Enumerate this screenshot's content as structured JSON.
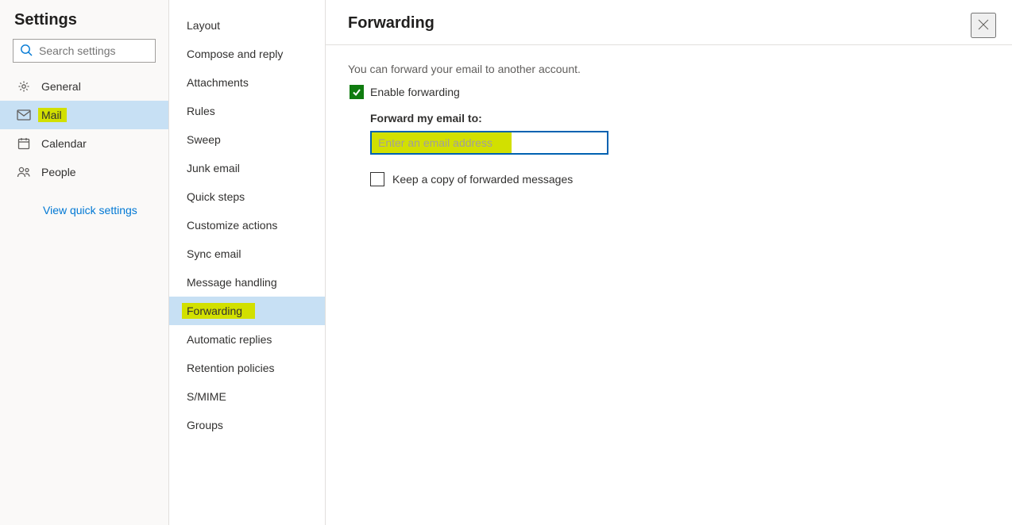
{
  "left": {
    "heading": "Settings",
    "search_placeholder": "Search settings",
    "items": [
      {
        "id": "general",
        "label": "General",
        "icon": "gear"
      },
      {
        "id": "mail",
        "label": "Mail",
        "icon": "mail",
        "selected": true,
        "highlight": true
      },
      {
        "id": "calendar",
        "label": "Calendar",
        "icon": "calendar"
      },
      {
        "id": "people",
        "label": "People",
        "icon": "people"
      }
    ],
    "quick_settings_label": "View quick settings"
  },
  "mid": {
    "items": [
      {
        "id": "layout",
        "label": "Layout"
      },
      {
        "id": "compose-reply",
        "label": "Compose and reply"
      },
      {
        "id": "attachments",
        "label": "Attachments"
      },
      {
        "id": "rules",
        "label": "Rules"
      },
      {
        "id": "sweep",
        "label": "Sweep"
      },
      {
        "id": "junk-email",
        "label": "Junk email"
      },
      {
        "id": "quick-steps",
        "label": "Quick steps"
      },
      {
        "id": "customize-actions",
        "label": "Customize actions"
      },
      {
        "id": "sync-email",
        "label": "Sync email"
      },
      {
        "id": "message-handling",
        "label": "Message handling"
      },
      {
        "id": "forwarding",
        "label": "Forwarding",
        "selected": true,
        "highlight": true
      },
      {
        "id": "automatic-replies",
        "label": "Automatic replies"
      },
      {
        "id": "retention-policies",
        "label": "Retention policies"
      },
      {
        "id": "smime",
        "label": "S/MIME"
      },
      {
        "id": "groups",
        "label": "Groups"
      }
    ]
  },
  "main": {
    "title": "Forwarding",
    "intro": "You can forward your email to another account.",
    "enable_label": "Enable forwarding",
    "enable_checked": true,
    "forward_to_label": "Forward my email to:",
    "forward_to_placeholder": "Enter an email address",
    "forward_to_value": "",
    "keep_copy_label": "Keep a copy of forwarded messages",
    "keep_copy_checked": false
  },
  "colors": {
    "selection": "#c7e0f4",
    "highlight": "#d2e000",
    "accent": "#0062b1",
    "checkbox_checked": "#107c10",
    "link": "#0078d4"
  }
}
